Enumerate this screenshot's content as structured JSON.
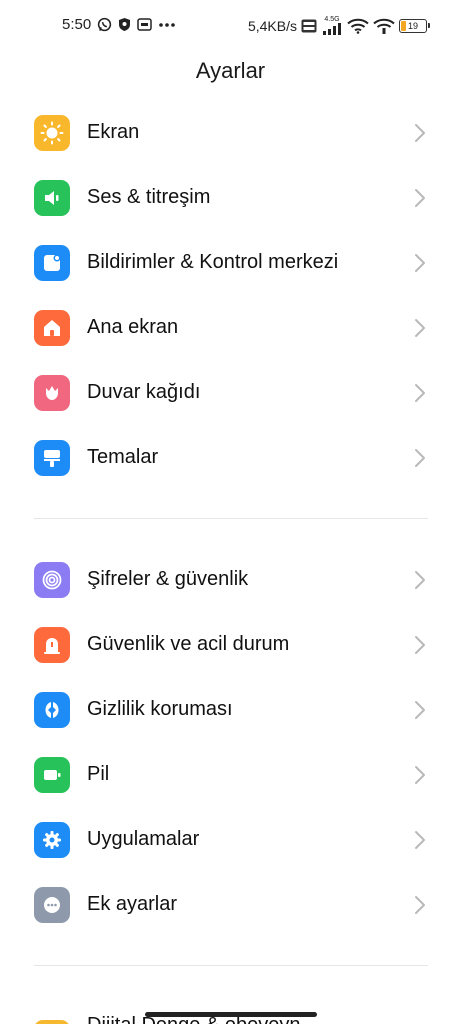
{
  "status_bar": {
    "time": "5:50",
    "net_speed": "5,4KB/s",
    "network_type": "4.5G",
    "battery_level": "19",
    "icons": [
      "whatsapp-icon",
      "shield-icon",
      "id-card-icon",
      "more-dots-icon",
      "volte-icon",
      "signal-icon",
      "wifi-icon",
      "hotspot-icon",
      "battery-icon"
    ]
  },
  "header": {
    "title": "Ayarlar"
  },
  "groups": [
    {
      "items": [
        {
          "label": "Ekran",
          "icon": "sun-icon",
          "color": "#f9b72c"
        },
        {
          "label": "Ses & titreşim",
          "icon": "speaker-icon",
          "color": "#27c25a"
        },
        {
          "label": "Bildirimler & Kontrol merkezi",
          "icon": "notification-icon",
          "color": "#1e8cf7"
        },
        {
          "label": "Ana ekran",
          "icon": "home-icon",
          "color": "#ff6a3d"
        },
        {
          "label": "Duvar kağıdı",
          "icon": "tulip-icon",
          "color": "#f0677f"
        },
        {
          "label": "Temalar",
          "icon": "paint-roller-icon",
          "color": "#1e8cf7"
        }
      ]
    },
    {
      "items": [
        {
          "label": "Şifreler & güvenlik",
          "icon": "fingerprint-icon",
          "color": "#8c7cf3"
        },
        {
          "label": "Güvenlik ve acil durum",
          "icon": "emergency-icon",
          "color": "#ff6a3d"
        },
        {
          "label": "Gizlilik koruması",
          "icon": "privacy-icon",
          "color": "#1e8cf7"
        },
        {
          "label": "Pil",
          "icon": "battery-app-icon",
          "color": "#27c25a"
        },
        {
          "label": "Uygulamalar",
          "icon": "gear-icon",
          "color": "#1e8cf7"
        },
        {
          "label": "Ek ayarlar",
          "icon": "more-settings-icon",
          "color": "#8e9aab"
        }
      ]
    }
  ],
  "partial_item": {
    "label": "Dijital Denge & ebeveyn",
    "icon": "digital-wellbeing-icon",
    "color": "#f5b82e"
  }
}
